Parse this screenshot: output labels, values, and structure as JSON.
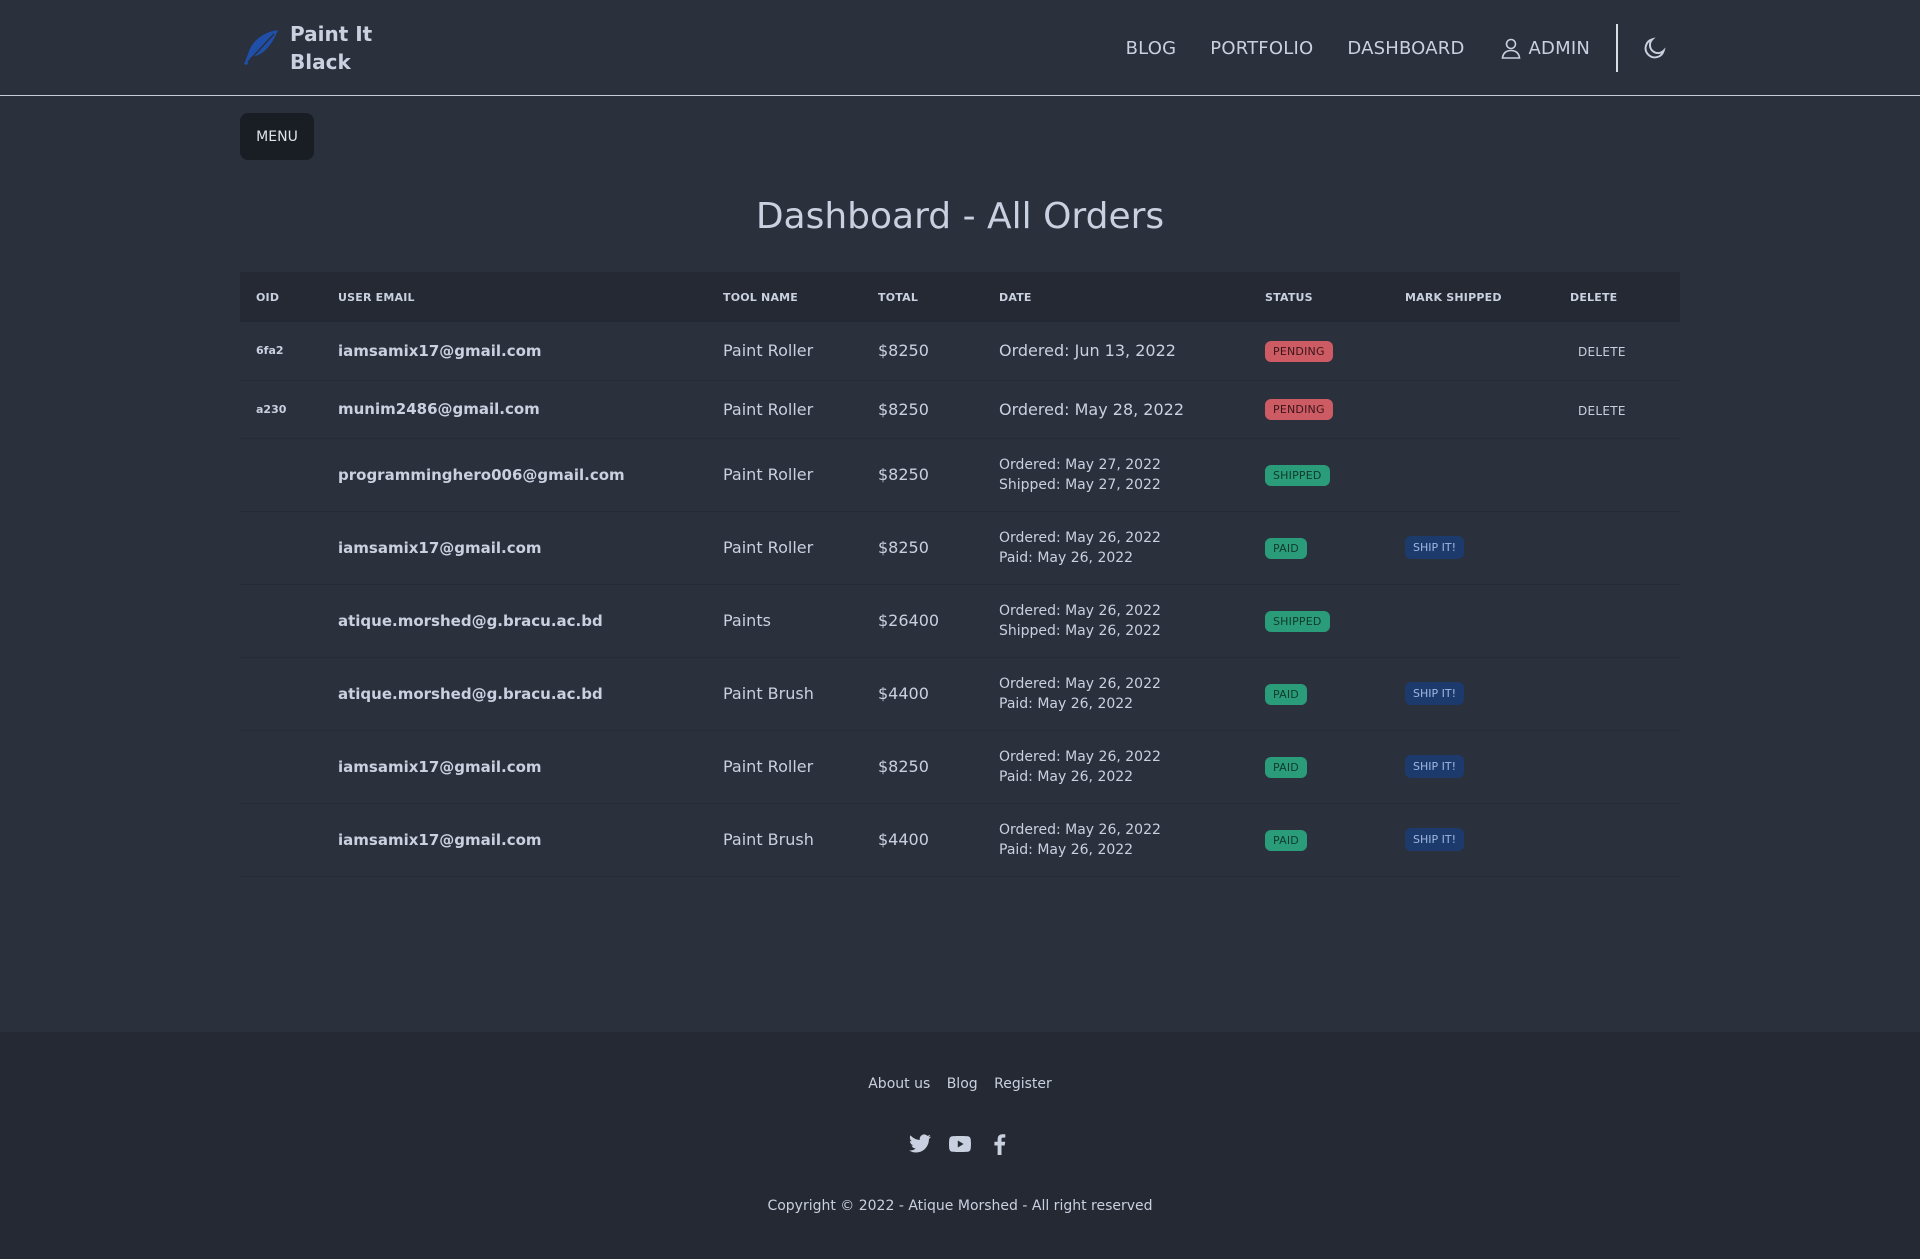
{
  "brand": {
    "name_line1": "Paint It",
    "name_line2": "Black",
    "icon": "feather-icon"
  },
  "nav": {
    "blog": "BLOG",
    "portfolio": "PORTFOLIO",
    "dashboard": "DASHBOARD",
    "admin": "ADMIN",
    "theme_icon": "moon-icon"
  },
  "menu_label": "MENU",
  "page_title": "Dashboard - All Orders",
  "table": {
    "headers": [
      "OID",
      "USER EMAIL",
      "TOOL NAME",
      "TOTAL",
      "DATE",
      "STATUS",
      "MARK SHIPPED",
      "DELETE"
    ],
    "rows": [
      {
        "oid": "6fa2",
        "email": "iamsamix17@gmail.com",
        "tool": "Paint Roller",
        "total": "$8250",
        "date1": "Ordered: Jun 13, 2022",
        "date2": "",
        "status": "PENDING",
        "ship": "",
        "delete": "DELETE"
      },
      {
        "oid": "a230",
        "email": "munim2486@gmail.com",
        "tool": "Paint Roller",
        "total": "$8250",
        "date1": "Ordered: May 28, 2022",
        "date2": "",
        "status": "PENDING",
        "ship": "",
        "delete": "DELETE"
      },
      {
        "oid": "",
        "email": "programminghero006@gmail.com",
        "tool": "Paint Roller",
        "total": "$8250",
        "date1": "Ordered: May 27, 2022",
        "date2": "Shipped: May 27, 2022",
        "status": "SHIPPED",
        "ship": "",
        "delete": ""
      },
      {
        "oid": "",
        "email": "iamsamix17@gmail.com",
        "tool": "Paint Roller",
        "total": "$8250",
        "date1": "Ordered: May 26, 2022",
        "date2": "Paid: May 26, 2022",
        "status": "PAID",
        "ship": "SHIP IT!",
        "delete": ""
      },
      {
        "oid": "",
        "email": "atique.morshed@g.bracu.ac.bd",
        "tool": "Paints",
        "total": "$26400",
        "date1": "Ordered: May 26, 2022",
        "date2": "Shipped: May 26, 2022",
        "status": "SHIPPED",
        "ship": "",
        "delete": ""
      },
      {
        "oid": "",
        "email": "atique.morshed@g.bracu.ac.bd",
        "tool": "Paint Brush",
        "total": "$4400",
        "date1": "Ordered: May 26, 2022",
        "date2": "Paid: May 26, 2022",
        "status": "PAID",
        "ship": "SHIP IT!",
        "delete": ""
      },
      {
        "oid": "",
        "email": "iamsamix17@gmail.com",
        "tool": "Paint Roller",
        "total": "$8250",
        "date1": "Ordered: May 26, 2022",
        "date2": "Paid: May 26, 2022",
        "status": "PAID",
        "ship": "SHIP IT!",
        "delete": ""
      },
      {
        "oid": "",
        "email": "iamsamix17@gmail.com",
        "tool": "Paint Brush",
        "total": "$4400",
        "date1": "Ordered: May 26, 2022",
        "date2": "Paid: May 26, 2022",
        "status": "PAID",
        "ship": "SHIP IT!",
        "delete": ""
      }
    ]
  },
  "footer": {
    "links": [
      "About us",
      "Blog",
      "Register"
    ],
    "socials": [
      "twitter-icon",
      "youtube-icon",
      "facebook-icon"
    ],
    "copyright": "Copyright © 2022 - Atique Morshed - All right reserved"
  },
  "colors": {
    "background": "#2a303c",
    "pending": "#cd5b64",
    "success": "#2b9c79",
    "ship_button": "#1d3a6d",
    "brand_icon": "#1f4fa8"
  }
}
